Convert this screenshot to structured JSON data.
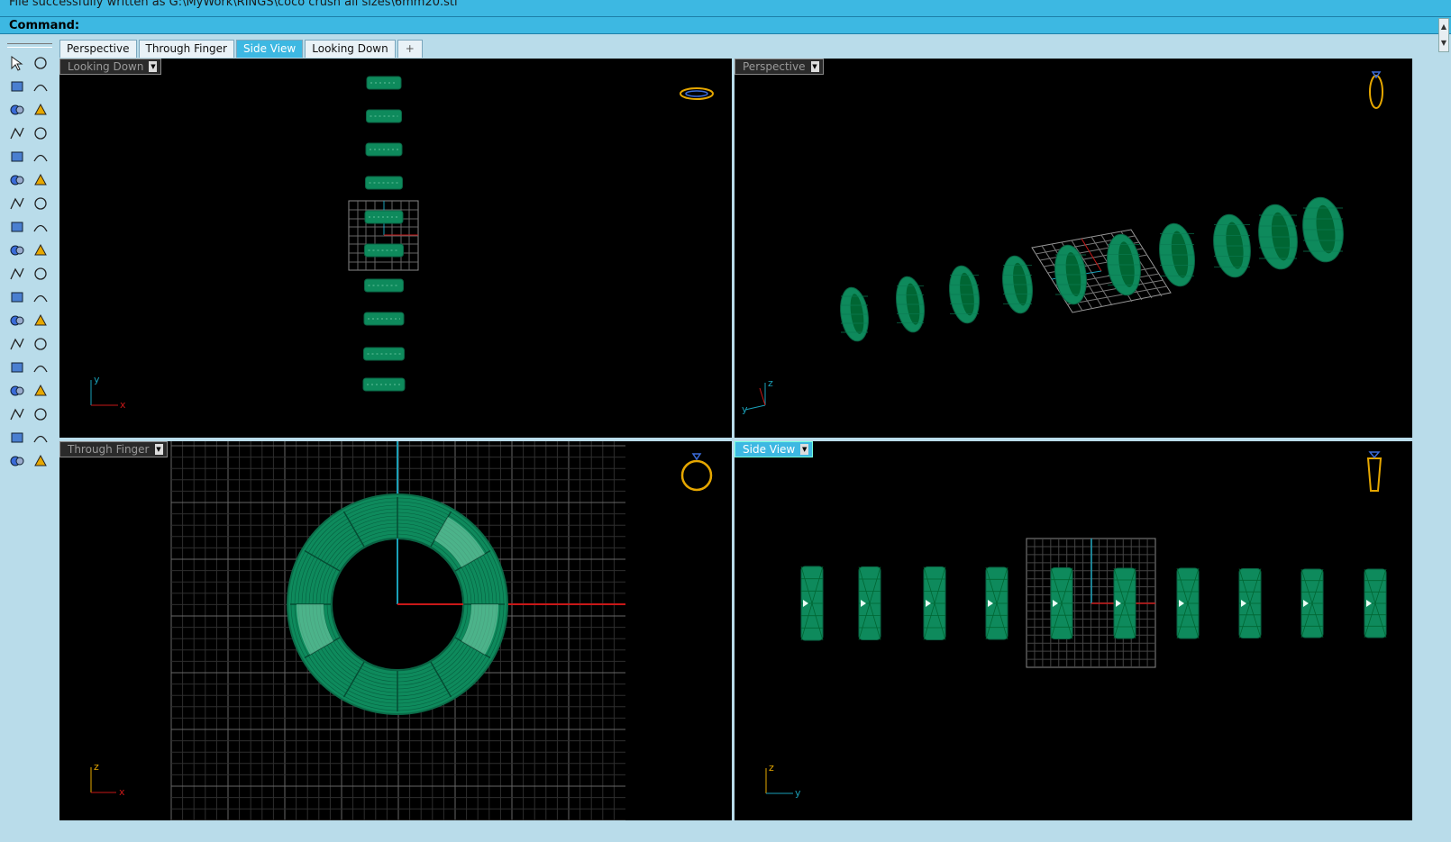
{
  "command": {
    "history_text": "File successfully written as G:\\MyWork\\RINGS\\coco crush all sizes\\6mm20.stl",
    "prompt_label": "Command:"
  },
  "tabs": [
    {
      "label": "Perspective",
      "active": false
    },
    {
      "label": "Through Finger",
      "active": false
    },
    {
      "label": "Side View",
      "active": true
    },
    {
      "label": "Looking Down",
      "active": false
    },
    {
      "label": "+",
      "active": false
    }
  ],
  "viewports": {
    "top_left": {
      "title": "Looking Down",
      "axes": [
        "y",
        "x"
      ]
    },
    "top_right": {
      "title": "Perspective",
      "axes": [
        "z",
        "y"
      ]
    },
    "bottom_left": {
      "title": "Through Finger",
      "axes": [
        "z",
        "x"
      ]
    },
    "bottom_right": {
      "title": "Side View",
      "axes": [
        "z",
        "y"
      ],
      "active": true
    }
  },
  "toolbox": {
    "icons": [
      "select-arrow-icon",
      "point-icon",
      "polyline-icon",
      "curve-control-points-icon",
      "circle-icon",
      "ellipse-icon",
      "arc-icon",
      "rectangle-icon",
      "polygon-icon",
      "fillet-curve-icon",
      "surface-from-points-icon",
      "loft-icon",
      "box-solid-icon",
      "sphere-solid-icon",
      "cylinder-icon",
      "plane-surface-icon",
      "gear-settings-icon",
      "explode-icon",
      "trim-icon",
      "split-icon",
      "boolean-union-icon",
      "group-icon",
      "offset-curve-icon",
      "rebuild-curve-icon",
      "text-icon",
      "scale-icon",
      "transform-icon",
      "analyze-icon",
      "solid-tools-icon",
      "array-icon",
      "grid-array-icon",
      "dimension-icon",
      "mesh-tools-icon",
      "check-icon",
      "render-icon",
      "paint-icon"
    ]
  },
  "colors": {
    "ring_fill": "#0e8a5c",
    "ring_highlight": "#7fd6b0",
    "command_bar": "#3db8e2",
    "axis_x": "#c81818",
    "axis_y": "#1aa0b8",
    "gumball": "#e6a700"
  }
}
